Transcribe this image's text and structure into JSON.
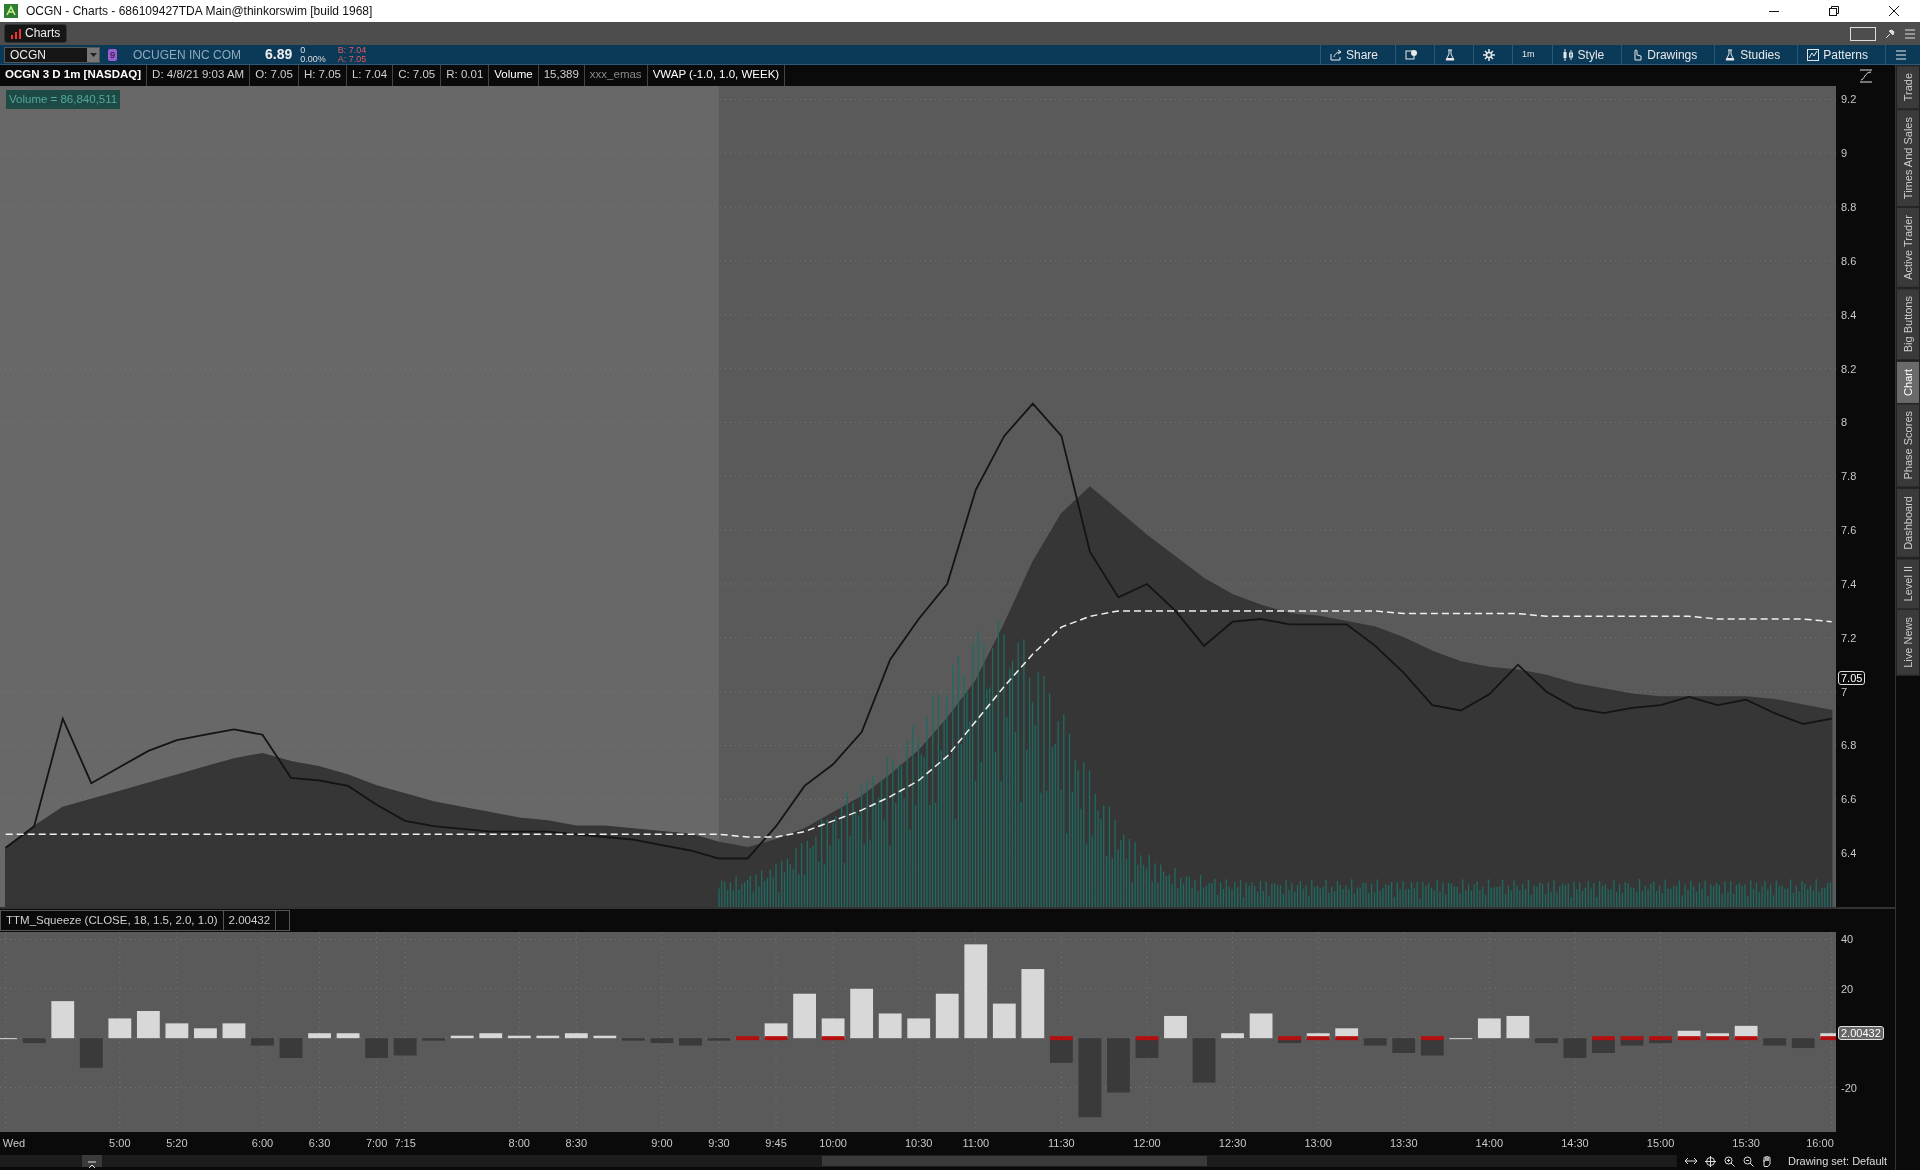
{
  "window": {
    "title": "OCGN - Charts - 686109427TDA Main@thinkorswim [build 1968]"
  },
  "tabs": [
    {
      "label": "Charts",
      "selected": true
    }
  ],
  "toolbar": {
    "symbol": "OCGN",
    "link_badge": "9",
    "company": "OCUGEN INC COM",
    "last": "6.89",
    "change": "0",
    "change_pct": "0.00%",
    "bid": "B: 7.04",
    "ask": "A: 7.05",
    "buttons": [
      {
        "kind": "share",
        "label": "Share"
      },
      {
        "kind": "alert"
      },
      {
        "kind": "flask"
      },
      {
        "kind": "gear"
      },
      {
        "kind": "timeframe",
        "label": "1m"
      },
      {
        "kind": "style",
        "label": "Style"
      },
      {
        "kind": "drawings",
        "label": "Drawings"
      },
      {
        "kind": "studies",
        "label": "Studies"
      },
      {
        "kind": "patterns",
        "label": "Patterns"
      },
      {
        "kind": "menu"
      }
    ]
  },
  "study_header": [
    {
      "kind": "title",
      "text": "OCGN 3 D 1m [NASDAQ]"
    },
    {
      "kind": "value",
      "text": "D: 4/8/21 9:03 AM"
    },
    {
      "kind": "value",
      "text": "O: 7.05"
    },
    {
      "kind": "value",
      "text": "H: 7.05"
    },
    {
      "kind": "value",
      "text": "L: 7.04"
    },
    {
      "kind": "value",
      "text": "C: 7.05"
    },
    {
      "kind": "value",
      "text": "R: 0.01"
    },
    {
      "kind": "study",
      "text": "Volume"
    },
    {
      "kind": "value",
      "text": "15,389"
    },
    {
      "kind": "hidden_study",
      "text": "xxx_emas"
    },
    {
      "kind": "study",
      "text": "VWAP (-1.0, 1.0, WEEK)"
    }
  ],
  "price_chart": {
    "volume_label": "Volume = 86,840,511",
    "chart_data": {
      "type": "line",
      "grid": true,
      "ylim": [
        6.2,
        9.25
      ],
      "yticks": [
        9.2,
        9,
        8.8,
        8.6,
        8.4,
        8.2,
        8,
        7.8,
        7.6,
        7.4,
        7.2,
        7,
        6.8,
        6.6,
        6.4
      ],
      "series": [
        {
          "type": "area",
          "color": "#363636",
          "values": [
            6.42,
            6.5,
            6.57,
            6.6,
            6.63,
            6.66,
            6.69,
            6.72,
            6.75,
            6.77,
            6.74,
            6.72,
            6.69,
            6.65,
            6.62,
            6.59,
            6.57,
            6.55,
            6.53,
            6.52,
            6.5,
            6.5,
            6.49,
            6.48,
            6.47,
            6.44,
            6.42,
            6.45,
            6.49,
            6.55,
            6.61,
            6.69,
            6.78,
            6.9,
            7.04,
            7.25,
            7.48,
            7.66,
            7.76,
            7.67,
            7.58,
            7.5,
            7.42,
            7.36,
            7.32,
            7.29,
            7.28,
            7.26,
            7.24,
            7.2,
            7.15,
            7.11,
            7.09,
            7.08,
            7.06,
            7.03,
            7.01,
            6.99,
            6.98,
            6.98,
            6.98,
            6.98,
            6.97,
            6.95,
            6.93
          ]
        },
        {
          "color": "#141414",
          "values": [
            6.42,
            6.5,
            6.9,
            6.66,
            6.72,
            6.78,
            6.82,
            6.84,
            6.86,
            6.84,
            6.68,
            6.67,
            6.65,
            6.58,
            6.52,
            6.5,
            6.49,
            6.48,
            6.48,
            6.48,
            6.47,
            6.46,
            6.45,
            6.43,
            6.41,
            6.38,
            6.38,
            6.5,
            6.65,
            6.73,
            6.85,
            7.12,
            7.27,
            7.4,
            7.75,
            7.95,
            8.07,
            7.95,
            7.52,
            7.35,
            7.4,
            7.3,
            7.17,
            7.26,
            7.27,
            7.25,
            7.25,
            7.25,
            7.17,
            7.07,
            6.95,
            6.93,
            6.99,
            7.1,
            7.0,
            6.94,
            6.92,
            6.94,
            6.95,
            6.98,
            6.95,
            6.97,
            6.92,
            6.88,
            6.9
          ]
        },
        {
          "color": "#f0f0f0",
          "line_style": "dashed",
          "values": [
            6.47,
            6.47,
            6.47,
            6.47,
            6.47,
            6.47,
            6.47,
            6.47,
            6.47,
            6.47,
            6.47,
            6.47,
            6.47,
            6.47,
            6.47,
            6.47,
            6.47,
            6.47,
            6.47,
            6.47,
            6.47,
            6.47,
            6.47,
            6.47,
            6.47,
            6.47,
            6.46,
            6.46,
            6.48,
            6.52,
            6.56,
            6.61,
            6.67,
            6.76,
            6.89,
            7.02,
            7.14,
            7.24,
            7.28,
            7.3,
            7.3,
            7.3,
            7.3,
            7.3,
            7.3,
            7.3,
            7.3,
            7.3,
            7.3,
            7.29,
            7.29,
            7.29,
            7.29,
            7.29,
            7.28,
            7.28,
            7.28,
            7.28,
            7.28,
            7.28,
            7.27,
            7.27,
            7.27,
            7.27,
            7.26
          ]
        }
      ],
      "annotations": [
        {
          "y": 7.05,
          "text": "7.05"
        }
      ]
    }
  },
  "squeeze": {
    "header": "TTM_Squeeze (CLOSE, 18, 1.5, 2.0, 1.0)",
    "value": "2.00432",
    "chart_data": {
      "type": "bar",
      "grid": true,
      "ylim": [
        -38,
        43
      ],
      "yticks": [
        40,
        20,
        -20
      ],
      "categories": [
        "Wed",
        null,
        null,
        null,
        "5:00",
        null,
        "5:20",
        null,
        null,
        "6:00",
        null,
        "6:30",
        null,
        "7:00",
        "7:15",
        null,
        null,
        null,
        "8:00",
        null,
        "8:30",
        null,
        null,
        "9:00",
        null,
        "9:30",
        null,
        "9:45",
        null,
        "10:00",
        null,
        null,
        "10:30",
        null,
        "11:00",
        null,
        null,
        "11:30",
        null,
        null,
        "12:00",
        null,
        null,
        "12:30",
        null,
        null,
        "13:00",
        null,
        null,
        "13:30",
        null,
        null,
        "14:00",
        null,
        null,
        "14:30",
        null,
        null,
        "15:00",
        null,
        null,
        "15:30",
        null,
        null,
        "16:00"
      ],
      "series": [
        {
          "color": "#d8d8d8",
          "values": [
            0,
            null,
            15,
            null,
            8,
            11,
            6,
            4,
            6,
            null,
            null,
            2,
            2,
            null,
            null,
            null,
            1,
            2,
            1,
            1,
            2,
            1,
            null,
            null,
            null,
            null,
            null,
            6,
            18,
            8,
            20,
            10,
            8,
            18,
            38,
            14,
            28,
            null,
            null,
            null,
            null,
            9,
            null,
            2,
            10,
            null,
            2,
            4,
            null,
            null,
            null,
            0,
            8,
            9,
            null,
            null,
            null,
            null,
            null,
            3,
            2,
            5,
            null,
            null,
            2
          ]
        },
        {
          "color": "#3a3a3a",
          "values": [
            null,
            -2,
            null,
            -12,
            null,
            null,
            null,
            null,
            null,
            -3,
            -8,
            null,
            null,
            -8,
            -7,
            -1,
            null,
            null,
            null,
            null,
            null,
            null,
            -1,
            -2,
            -3,
            -1,
            null,
            null,
            null,
            null,
            null,
            null,
            null,
            null,
            null,
            null,
            null,
            -10,
            -32,
            -22,
            -8,
            null,
            -18,
            null,
            null,
            -2,
            null,
            null,
            -3,
            -6,
            -7,
            null,
            null,
            null,
            -2,
            -8,
            -6,
            -3,
            -2,
            null,
            null,
            null,
            -3,
            -4,
            null
          ]
        },
        {
          "color": "#b30f0f",
          "values": [
            null,
            null,
            null,
            null,
            null,
            null,
            null,
            null,
            null,
            null,
            null,
            null,
            null,
            null,
            null,
            null,
            null,
            null,
            null,
            null,
            null,
            null,
            null,
            null,
            null,
            null,
            0,
            0,
            null,
            0,
            null,
            null,
            null,
            null,
            null,
            null,
            null,
            0,
            null,
            null,
            0,
            null,
            null,
            null,
            null,
            0,
            0,
            0,
            null,
            null,
            0,
            null,
            null,
            null,
            null,
            null,
            0,
            0,
            0,
            0,
            0,
            0,
            null,
            null,
            0
          ]
        }
      ],
      "annotations": [
        {
          "text": "2.00432"
        }
      ]
    }
  },
  "side_tabs": [
    {
      "label": "Trade",
      "selected": false
    },
    {
      "label": "Times And Sales",
      "selected": false
    },
    {
      "label": "Active Trader",
      "selected": false
    },
    {
      "label": "Big Buttons",
      "selected": false
    },
    {
      "label": "Chart",
      "selected": true
    },
    {
      "label": "Phase Scores",
      "selected": false
    },
    {
      "label": "Dashboard",
      "selected": false
    },
    {
      "label": "Level II",
      "selected": false
    },
    {
      "label": "Live News",
      "selected": false
    }
  ],
  "status_bar": {
    "drawing_set": "Drawing set: Default"
  }
}
